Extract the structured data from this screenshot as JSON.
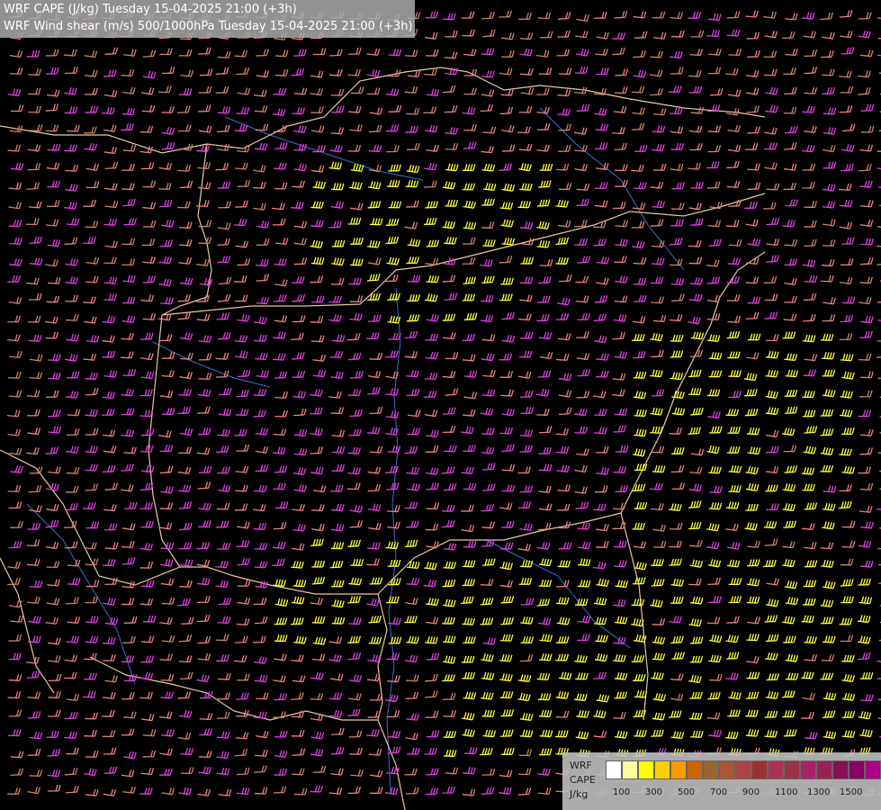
{
  "title": {
    "line1": "WRF CAPE (J/kg) Tuesday 15-04-2025 21:00 (+3h)",
    "line2": "WRF Wind shear (m/s) 500/1000hPa Tuesday 15-04-2025 21:00 (+3h)"
  },
  "legend": {
    "model": "WRF",
    "variable": "CAPE",
    "unit": "J/kg",
    "colors": [
      "#ffffff",
      "#ffff99",
      "#ffff00",
      "#ffcc00",
      "#ff9900",
      "#cc6600",
      "#996633",
      "#aa5533",
      "#aa4444",
      "#993333",
      "#aa3355",
      "#993344",
      "#aa2266",
      "#992255",
      "#881155",
      "#880066",
      "#aa0088"
    ],
    "ticks": [
      "100",
      "300",
      "500",
      "700",
      "900",
      "1100",
      "1300",
      "1500"
    ]
  },
  "map": {
    "barb_colors": {
      "low": "#d0826a",
      "mid": "#f08080",
      "high": "#e040e0",
      "cape": "#ffff33"
    },
    "border_color": "#e8c8a0",
    "river_color": "#3a6fd0"
  }
}
